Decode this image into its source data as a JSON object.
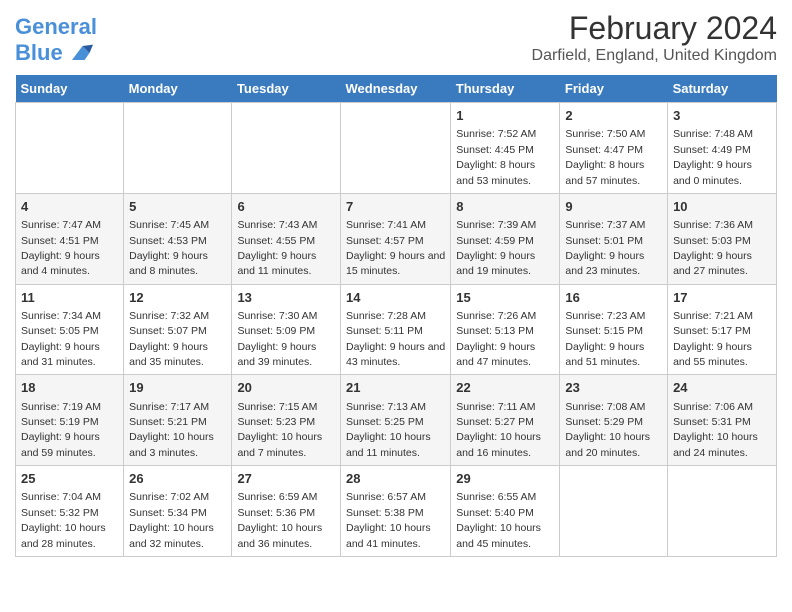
{
  "header": {
    "logo_line1": "General",
    "logo_line2": "Blue",
    "title": "February 2024",
    "subtitle": "Darfield, England, United Kingdom"
  },
  "weekdays": [
    "Sunday",
    "Monday",
    "Tuesday",
    "Wednesday",
    "Thursday",
    "Friday",
    "Saturday"
  ],
  "weeks": [
    [
      {
        "day": "",
        "info": ""
      },
      {
        "day": "",
        "info": ""
      },
      {
        "day": "",
        "info": ""
      },
      {
        "day": "",
        "info": ""
      },
      {
        "day": "1",
        "info": "Sunrise: 7:52 AM\nSunset: 4:45 PM\nDaylight: 8 hours and 53 minutes."
      },
      {
        "day": "2",
        "info": "Sunrise: 7:50 AM\nSunset: 4:47 PM\nDaylight: 8 hours and 57 minutes."
      },
      {
        "day": "3",
        "info": "Sunrise: 7:48 AM\nSunset: 4:49 PM\nDaylight: 9 hours and 0 minutes."
      }
    ],
    [
      {
        "day": "4",
        "info": "Sunrise: 7:47 AM\nSunset: 4:51 PM\nDaylight: 9 hours and 4 minutes."
      },
      {
        "day": "5",
        "info": "Sunrise: 7:45 AM\nSunset: 4:53 PM\nDaylight: 9 hours and 8 minutes."
      },
      {
        "day": "6",
        "info": "Sunrise: 7:43 AM\nSunset: 4:55 PM\nDaylight: 9 hours and 11 minutes."
      },
      {
        "day": "7",
        "info": "Sunrise: 7:41 AM\nSunset: 4:57 PM\nDaylight: 9 hours and 15 minutes."
      },
      {
        "day": "8",
        "info": "Sunrise: 7:39 AM\nSunset: 4:59 PM\nDaylight: 9 hours and 19 minutes."
      },
      {
        "day": "9",
        "info": "Sunrise: 7:37 AM\nSunset: 5:01 PM\nDaylight: 9 hours and 23 minutes."
      },
      {
        "day": "10",
        "info": "Sunrise: 7:36 AM\nSunset: 5:03 PM\nDaylight: 9 hours and 27 minutes."
      }
    ],
    [
      {
        "day": "11",
        "info": "Sunrise: 7:34 AM\nSunset: 5:05 PM\nDaylight: 9 hours and 31 minutes."
      },
      {
        "day": "12",
        "info": "Sunrise: 7:32 AM\nSunset: 5:07 PM\nDaylight: 9 hours and 35 minutes."
      },
      {
        "day": "13",
        "info": "Sunrise: 7:30 AM\nSunset: 5:09 PM\nDaylight: 9 hours and 39 minutes."
      },
      {
        "day": "14",
        "info": "Sunrise: 7:28 AM\nSunset: 5:11 PM\nDaylight: 9 hours and 43 minutes."
      },
      {
        "day": "15",
        "info": "Sunrise: 7:26 AM\nSunset: 5:13 PM\nDaylight: 9 hours and 47 minutes."
      },
      {
        "day": "16",
        "info": "Sunrise: 7:23 AM\nSunset: 5:15 PM\nDaylight: 9 hours and 51 minutes."
      },
      {
        "day": "17",
        "info": "Sunrise: 7:21 AM\nSunset: 5:17 PM\nDaylight: 9 hours and 55 minutes."
      }
    ],
    [
      {
        "day": "18",
        "info": "Sunrise: 7:19 AM\nSunset: 5:19 PM\nDaylight: 9 hours and 59 minutes."
      },
      {
        "day": "19",
        "info": "Sunrise: 7:17 AM\nSunset: 5:21 PM\nDaylight: 10 hours and 3 minutes."
      },
      {
        "day": "20",
        "info": "Sunrise: 7:15 AM\nSunset: 5:23 PM\nDaylight: 10 hours and 7 minutes."
      },
      {
        "day": "21",
        "info": "Sunrise: 7:13 AM\nSunset: 5:25 PM\nDaylight: 10 hours and 11 minutes."
      },
      {
        "day": "22",
        "info": "Sunrise: 7:11 AM\nSunset: 5:27 PM\nDaylight: 10 hours and 16 minutes."
      },
      {
        "day": "23",
        "info": "Sunrise: 7:08 AM\nSunset: 5:29 PM\nDaylight: 10 hours and 20 minutes."
      },
      {
        "day": "24",
        "info": "Sunrise: 7:06 AM\nSunset: 5:31 PM\nDaylight: 10 hours and 24 minutes."
      }
    ],
    [
      {
        "day": "25",
        "info": "Sunrise: 7:04 AM\nSunset: 5:32 PM\nDaylight: 10 hours and 28 minutes."
      },
      {
        "day": "26",
        "info": "Sunrise: 7:02 AM\nSunset: 5:34 PM\nDaylight: 10 hours and 32 minutes."
      },
      {
        "day": "27",
        "info": "Sunrise: 6:59 AM\nSunset: 5:36 PM\nDaylight: 10 hours and 36 minutes."
      },
      {
        "day": "28",
        "info": "Sunrise: 6:57 AM\nSunset: 5:38 PM\nDaylight: 10 hours and 41 minutes."
      },
      {
        "day": "29",
        "info": "Sunrise: 6:55 AM\nSunset: 5:40 PM\nDaylight: 10 hours and 45 minutes."
      },
      {
        "day": "",
        "info": ""
      },
      {
        "day": "",
        "info": ""
      }
    ]
  ]
}
